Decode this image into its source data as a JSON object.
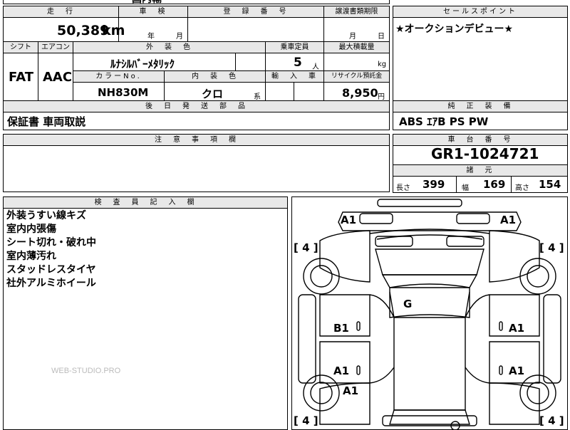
{
  "top_partial": "国内輸",
  "headers": {
    "mileage": "走　行",
    "inspection": "車　検",
    "reg_no": "登　録　番　号",
    "transfer": "譲渡書類期限",
    "sales_point": "セールスポイント",
    "shift": "シフト",
    "aircon": "エアコン",
    "ext_color": "外　装　色",
    "capacity": "乗車定員",
    "max_load": "最大積載量",
    "color_no": "カラーNo.",
    "int_color": "内　装　色",
    "import": "輸　入　車",
    "recycle": "リサイクル預託金",
    "follow_up": "後　日　発　送　部　品",
    "equipment": "純　正　装　備",
    "notes": "注　意　事　項　欄",
    "chassis": "車　台　番　号",
    "specs": "諸　元",
    "inspector": "検　査　員　記　入　欄"
  },
  "vehicle": {
    "mileage": "50,389",
    "mileage_unit": "km",
    "year_unit": "年",
    "month_unit": "月",
    "transfer_month": "月",
    "transfer_day": "日",
    "sales_point": "★オークションデビュー★",
    "shift": "FAT",
    "aircon": "AAC",
    "ext_color": "ﾙﾅｼﾙﾊﾞｰﾒﾀﾘｯｸ",
    "capacity": "5",
    "capacity_unit": "人",
    "load_unit": "kg",
    "color_no": "NH830M",
    "int_color": "クロ",
    "int_color_suffix": "系",
    "recycle_fee": "8,950",
    "recycle_unit": "円",
    "follow_up_parts": "保証書 車両取説",
    "equipment": "ABS ｴｱB PS PW",
    "chassis_no": "GR1-1024721",
    "length_label": "長さ",
    "length": "399",
    "width_label": "幅",
    "width": "169",
    "height_label": "高さ",
    "height": "154"
  },
  "inspector_notes": [
    "外装うすい線キズ",
    "室内内張傷",
    "シート切れ・破れ中",
    "室内薄汚れ",
    "スタッドレスタイヤ",
    "社外アルミホイール"
  ],
  "watermark": "WEB-STUDIO.PRO",
  "diagram": {
    "front_left": "A1",
    "front_right": "A1",
    "tire_fl": "[ 4 ]",
    "tire_fr": "[ 4 ]",
    "tire_rl": "[ 4 ]",
    "tire_rr": "[ 4 ]",
    "roof": "G",
    "left_front_door": "B1",
    "right_front_door": "A1",
    "left_rear_door": "A1",
    "right_rear_door": "A1",
    "left_rear_quarter": "A1"
  }
}
